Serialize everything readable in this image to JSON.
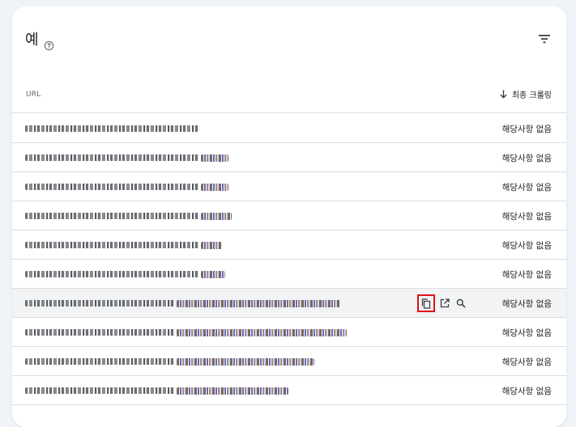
{
  "card": {
    "title": "예",
    "help_icon": "help-circle-icon",
    "filter_icon": "filter-list-icon"
  },
  "table": {
    "col_url": "URL",
    "col_crawl": "최종 크롤링",
    "sort_icon": "arrow-down-icon",
    "rows": [
      {
        "crawl": "해당사항 없음"
      },
      {
        "crawl": "해당사항 없음"
      },
      {
        "crawl": "해당사항 없음"
      },
      {
        "crawl": "해당사항 없음"
      },
      {
        "crawl": "해당사항 없음"
      },
      {
        "crawl": "해당사항 없음"
      },
      {
        "crawl": "해당사항 없음",
        "hovered": true
      },
      {
        "crawl": "해당사항 없음"
      },
      {
        "crawl": "해당사항 없음"
      },
      {
        "crawl": "해당사항 없음"
      }
    ],
    "row_actions": [
      "copy-icon",
      "open-in-new-icon",
      "search-icon"
    ]
  },
  "colors": {
    "background": "#f0f4f9",
    "card": "#ffffff",
    "divider": "#dadce0",
    "highlight_box": "#e0101a",
    "hover_row": "#f1f3f4"
  }
}
